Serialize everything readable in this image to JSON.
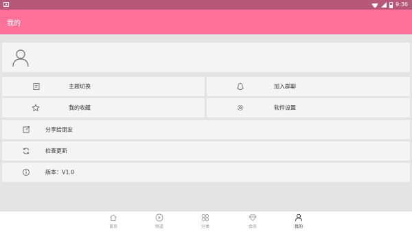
{
  "status_bar": {
    "time": "9:36"
  },
  "app_bar": {
    "title": "我的"
  },
  "menu": {
    "theme_switch": "主题切换",
    "join_group": "加入群聊",
    "favorites": "我的收藏",
    "settings": "软件设置",
    "share": "分享给朋友",
    "check_update": "检查更新",
    "version": "版本：V1.0"
  },
  "bottom_nav": {
    "items": [
      {
        "label": "首页",
        "icon": "home-icon"
      },
      {
        "label": "频道",
        "icon": "play-icon"
      },
      {
        "label": "分类",
        "icon": "grid-icon"
      },
      {
        "label": "会员",
        "icon": "diamond-icon"
      },
      {
        "label": "我的",
        "icon": "user-icon",
        "active": true
      }
    ]
  },
  "colors": {
    "accent": "#fd7199",
    "status_bar": "#b85878",
    "background": "#e3e3e3",
    "card": "#f4f4f4"
  }
}
